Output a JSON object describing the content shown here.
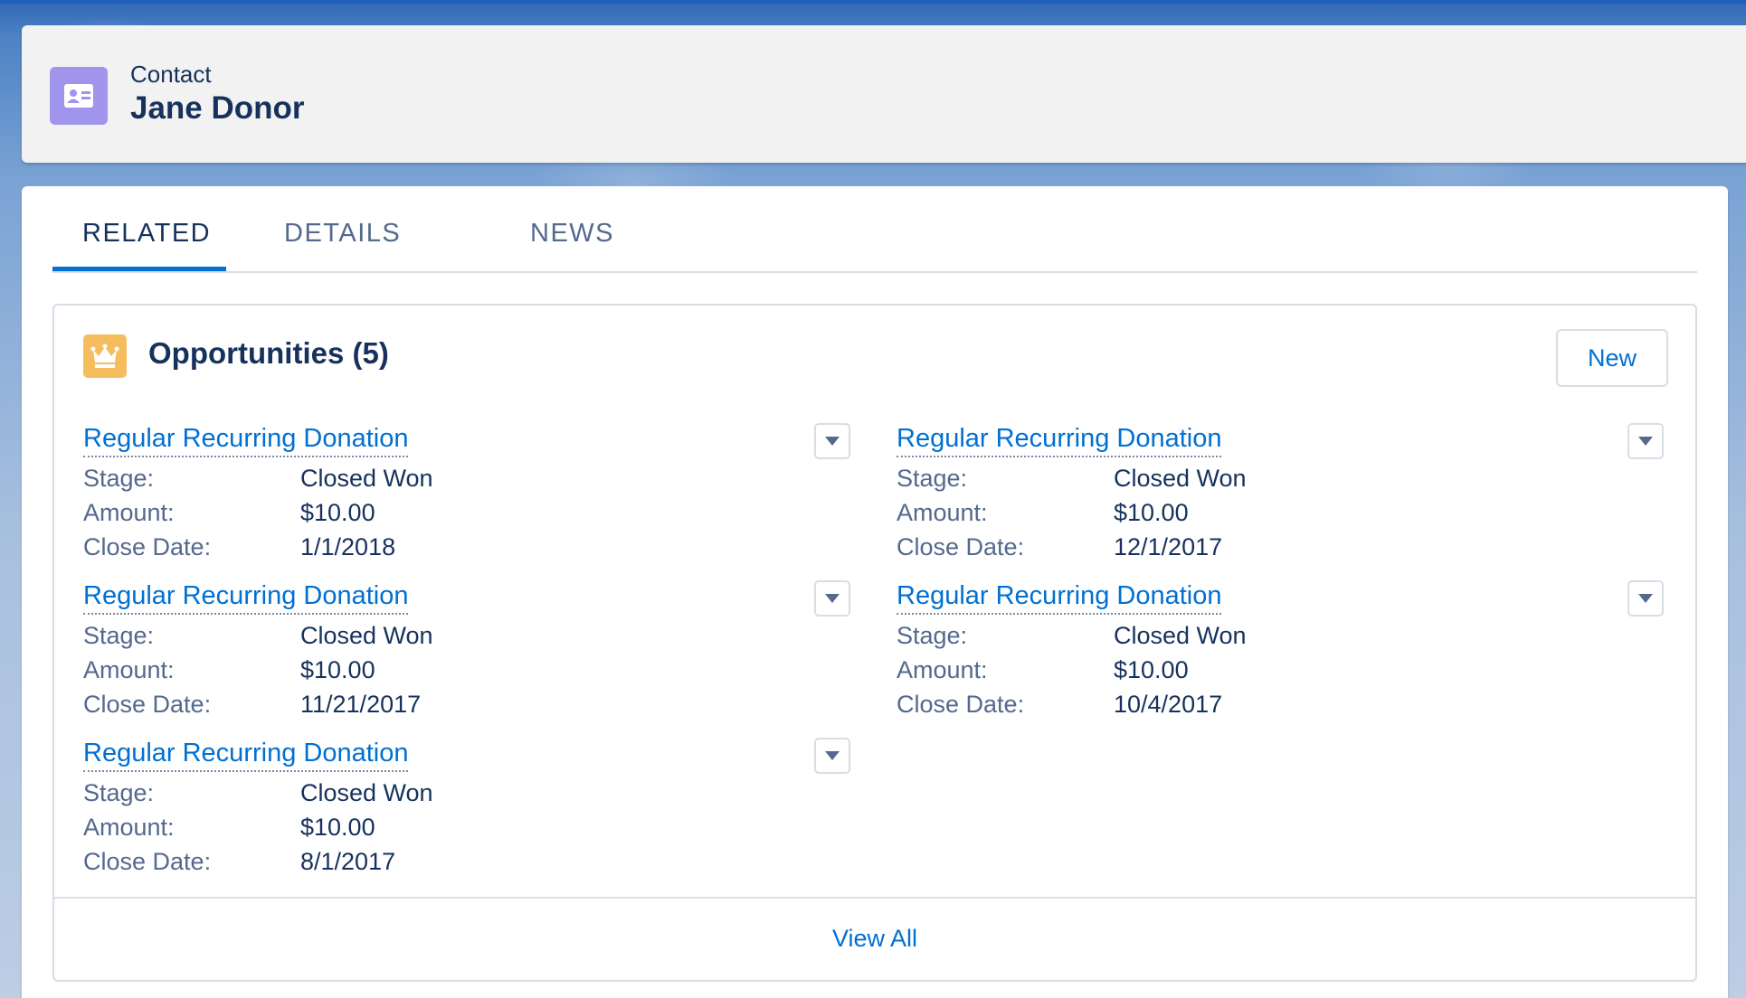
{
  "header": {
    "object_label": "Contact",
    "record_name": "Jane Donor",
    "icon": "contact-card-icon"
  },
  "tabs": [
    {
      "label": "RELATED",
      "active": true
    },
    {
      "label": "DETAILS",
      "active": false
    },
    {
      "label": "NEWS",
      "active": false
    }
  ],
  "related_list": {
    "title": "Opportunities (5)",
    "icon": "crown-icon",
    "new_label": "New",
    "field_labels": {
      "stage": "Stage:",
      "amount": "Amount:",
      "close_date": "Close Date:"
    },
    "records": [
      {
        "name": "Regular Recurring Donation",
        "stage": "Closed Won",
        "amount": "$10.00",
        "close_date": "1/1/2018"
      },
      {
        "name": "Regular Recurring Donation",
        "stage": "Closed Won",
        "amount": "$10.00",
        "close_date": "12/1/2017"
      },
      {
        "name": "Regular Recurring Donation",
        "stage": "Closed Won",
        "amount": "$10.00",
        "close_date": "11/21/2017"
      },
      {
        "name": "Regular Recurring Donation",
        "stage": "Closed Won",
        "amount": "$10.00",
        "close_date": "10/4/2017"
      },
      {
        "name": "Regular Recurring Donation",
        "stage": "Closed Won",
        "amount": "$10.00",
        "close_date": "8/1/2017"
      }
    ],
    "view_all_label": "View All"
  },
  "colors": {
    "brand_blue": "#0070d2",
    "contact_icon": "#a094ed",
    "opportunity_icon": "#f6bd5f",
    "text_dark": "#16325c",
    "text_label": "#54698d"
  }
}
